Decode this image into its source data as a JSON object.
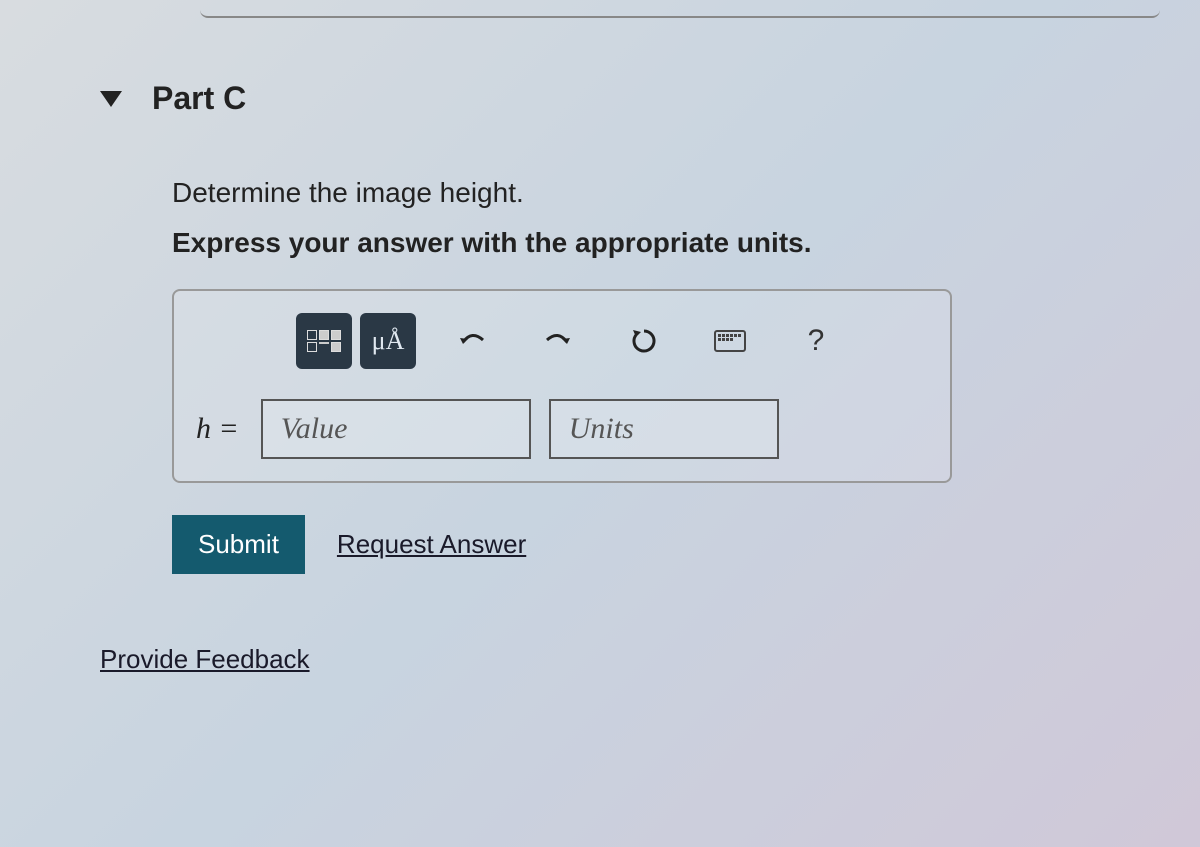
{
  "part": {
    "title": "Part C"
  },
  "prompt": "Determine the image height.",
  "instruction": "Express your answer with the appropriate units.",
  "toolbar": {
    "special_chars": "μÅ",
    "help": "?"
  },
  "input": {
    "variable": "h =",
    "value_placeholder": "Value",
    "units_placeholder": "Units"
  },
  "actions": {
    "submit": "Submit",
    "request_answer": "Request Answer"
  },
  "feedback": "Provide Feedback"
}
